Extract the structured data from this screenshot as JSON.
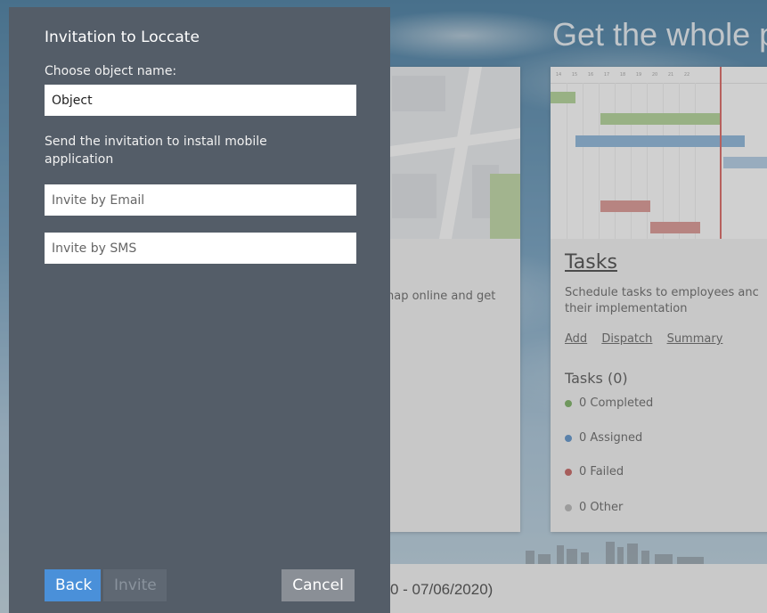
{
  "dialog": {
    "title": "Invitation to Loccate",
    "object_name_label": "Choose object name:",
    "object_name_value": "Object",
    "invite_label": "Send the invitation to install mobile application",
    "email_placeholder": "Invite by Email",
    "sms_placeholder": "Invite by SMS",
    "back_label": "Back",
    "invite_button_label": "Invite",
    "cancel_label": "Cancel"
  },
  "background": {
    "headline": "Get the whole p",
    "map_card_text": "nap online and get",
    "tasks_card": {
      "title": "Tasks",
      "description": "Schedule tasks to employees anc their implementation",
      "links": [
        "Add",
        "Dispatch",
        "Summary"
      ],
      "count_label": "Tasks (0)",
      "stats": [
        {
          "label": "0 Completed",
          "color": "#6aa84f"
        },
        {
          "label": "0 Assigned",
          "color": "#4a86c5"
        },
        {
          "label": "0 Failed",
          "color": "#c0504d"
        },
        {
          "label": "0 Other",
          "color": "#b0b0b0"
        }
      ]
    },
    "gantt_days": [
      "14",
      "15",
      "16",
      "17",
      "18",
      "19",
      "20",
      "21",
      "22"
    ],
    "date_range": "0 - 07/06/2020)"
  },
  "colors": {
    "dialog_bg": "#545d68",
    "primary_button": "#4a90d9",
    "cancel_button": "#8a8f96"
  }
}
